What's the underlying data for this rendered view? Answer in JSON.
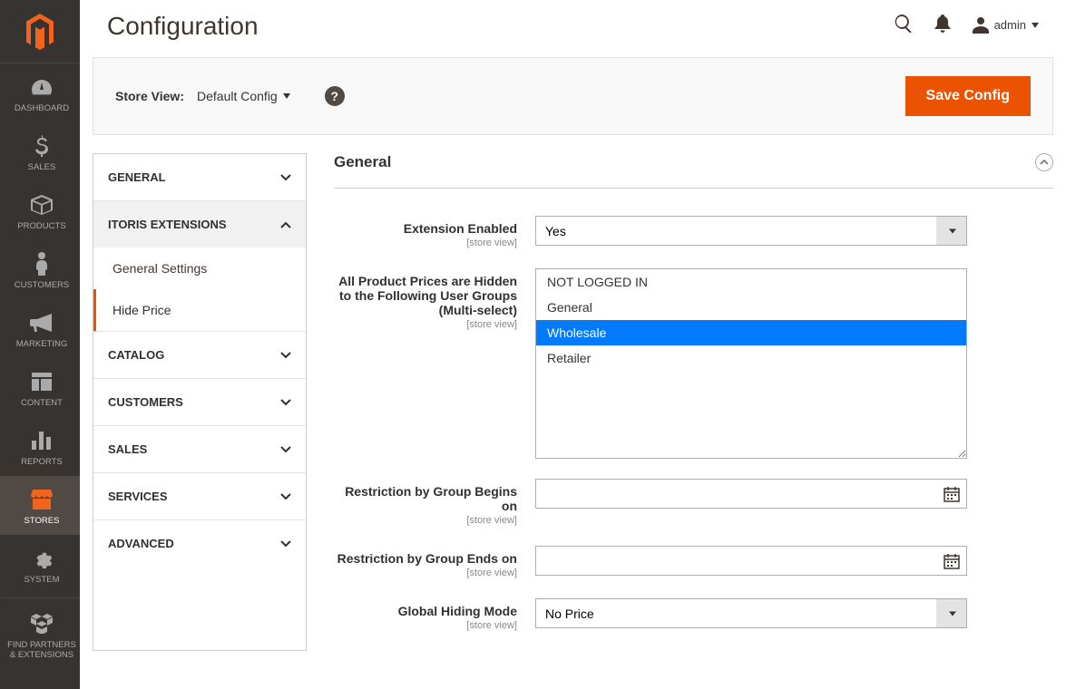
{
  "header": {
    "page_title": "Configuration",
    "admin_label": "admin"
  },
  "sidebar": {
    "items": [
      {
        "id": "dashboard",
        "label": "DASHBOARD"
      },
      {
        "id": "sales",
        "label": "SALES"
      },
      {
        "id": "products",
        "label": "PRODUCTS"
      },
      {
        "id": "customers",
        "label": "CUSTOMERS"
      },
      {
        "id": "marketing",
        "label": "MARKETING"
      },
      {
        "id": "content",
        "label": "CONTENT"
      },
      {
        "id": "reports",
        "label": "REPORTS"
      },
      {
        "id": "stores",
        "label": "STORES",
        "active": true
      },
      {
        "id": "system",
        "label": "SYSTEM"
      },
      {
        "id": "partners",
        "label": "FIND PARTNERS & EXTENSIONS"
      }
    ]
  },
  "toolbar": {
    "store_view_label": "Store View:",
    "store_view_value": "Default Config",
    "save_label": "Save Config"
  },
  "config_nav": {
    "sections": [
      {
        "id": "general",
        "label": "GENERAL",
        "expanded": false
      },
      {
        "id": "itoris",
        "label": "ITORIS EXTENSIONS",
        "expanded": true,
        "items": [
          {
            "id": "general_settings",
            "label": "General Settings",
            "active": false
          },
          {
            "id": "hide_price",
            "label": "Hide Price",
            "active": true
          }
        ]
      },
      {
        "id": "catalog",
        "label": "CATALOG",
        "expanded": false
      },
      {
        "id": "customers",
        "label": "CUSTOMERS",
        "expanded": false
      },
      {
        "id": "sales",
        "label": "SALES",
        "expanded": false
      },
      {
        "id": "services",
        "label": "SERVICES",
        "expanded": false
      },
      {
        "id": "advanced",
        "label": "ADVANCED",
        "expanded": false
      }
    ]
  },
  "form": {
    "fieldset_title": "General",
    "scope_text": "[store view]",
    "fields": {
      "extension_enabled": {
        "label": "Extension Enabled",
        "value": "Yes"
      },
      "hidden_groups": {
        "label": "All Product Prices are Hidden to the Following User Groups (Multi-select)",
        "options": [
          {
            "label": "NOT LOGGED IN",
            "selected": false
          },
          {
            "label": "General",
            "selected": false
          },
          {
            "label": "Wholesale",
            "selected": true
          },
          {
            "label": "Retailer",
            "selected": false
          }
        ]
      },
      "begins_on": {
        "label": "Restriction by Group Begins on",
        "value": ""
      },
      "ends_on": {
        "label": "Restriction by Group Ends on",
        "value": ""
      },
      "hiding_mode": {
        "label": "Global Hiding Mode",
        "value": "No Price"
      }
    }
  }
}
